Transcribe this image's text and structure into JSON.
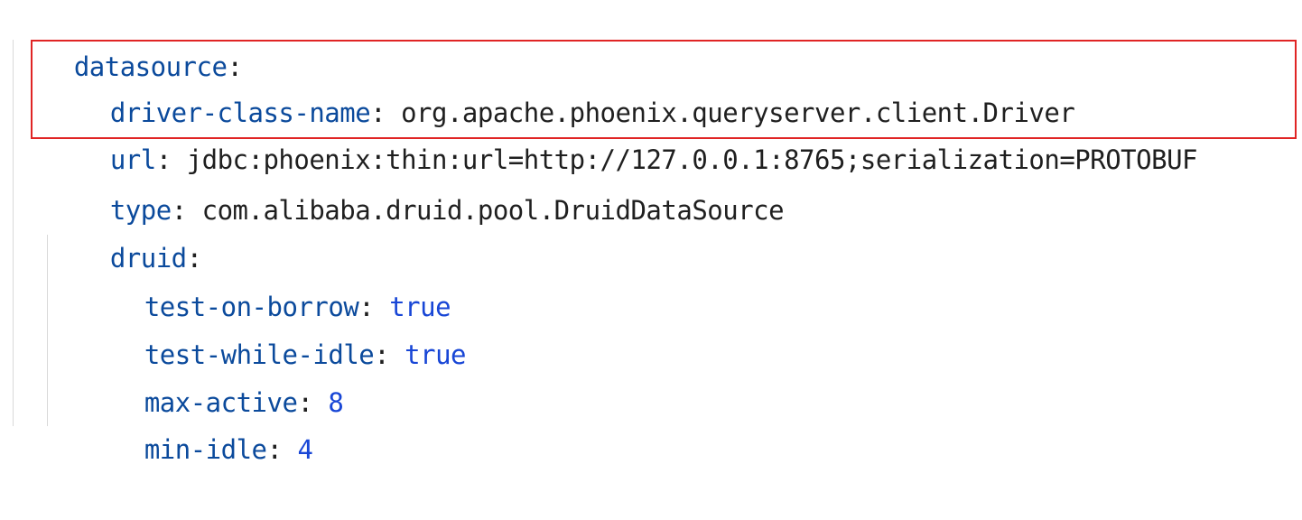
{
  "colors": {
    "key": "#0b4a9c",
    "string_value": "#1f1f1f",
    "boolean_value": "#1846d6",
    "number_value": "#107a4a",
    "highlight_border": "#e02424",
    "indent_guide": "#d9d9d9",
    "background": "#ffffff"
  },
  "yaml": {
    "root_key": "datasource",
    "driver_class_name": {
      "key": "driver-class-name",
      "value": "org.apache.phoenix.queryserver.client.Driver"
    },
    "url": {
      "key": "url",
      "value": "jdbc:phoenix:thin:url=http://127.0.0.1:8765;serialization=PROTOBUF"
    },
    "type": {
      "key": "type",
      "value": "com.alibaba.druid.pool.DruidDataSource"
    },
    "druid": {
      "key": "druid",
      "test_on_borrow": {
        "key": "test-on-borrow",
        "value": "true"
      },
      "test_while_idle": {
        "key": "test-while-idle",
        "value": "true"
      },
      "max_active": {
        "key": "max-active",
        "value": "8"
      },
      "min_idle": {
        "key": "min-idle",
        "value": "4"
      }
    }
  },
  "punctuation": {
    "colon": ":",
    "colon_space": ": "
  }
}
